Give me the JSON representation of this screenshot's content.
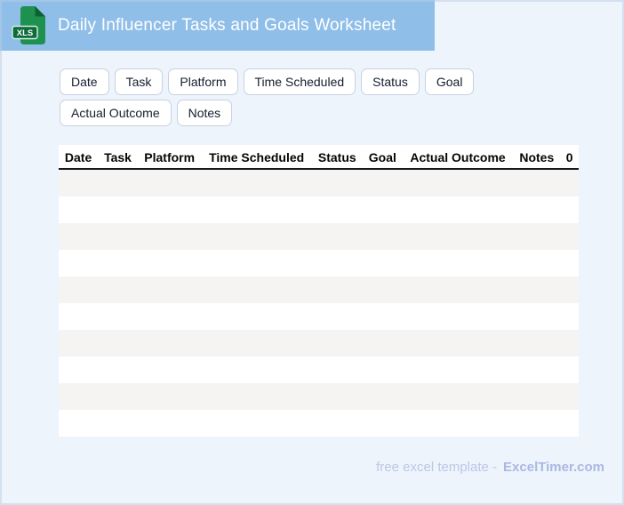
{
  "header": {
    "title": "Daily Influencer Tasks and Goals Worksheet",
    "file_badge_label": "XLS"
  },
  "tags": {
    "items": [
      "Date",
      "Task",
      "Platform",
      "Time Scheduled",
      "Status",
      "Goal",
      "Actual Outcome",
      "Notes"
    ]
  },
  "table": {
    "columns": [
      "Date",
      "Task",
      "Platform",
      "Time Scheduled",
      "Status",
      "Goal",
      "Actual Outcome",
      "Notes",
      "0"
    ],
    "row_count": 10,
    "rows": []
  },
  "footer": {
    "prefix": "free excel template -",
    "brand": "ExcelTimer.com"
  },
  "colors": {
    "header_band": "#8FBEE9",
    "page_background": "#EEF4FC",
    "row_stripe": "#F5F4F2",
    "header_rule": "#191919",
    "chip_border": "#C7D1E1",
    "icon_body_green": "#1E9150",
    "icon_fold_green": "#0C6232",
    "icon_badge_green": "#0E6B3C",
    "footer_text": "#BBC7E6",
    "footer_brand": "#A9B8E1"
  }
}
